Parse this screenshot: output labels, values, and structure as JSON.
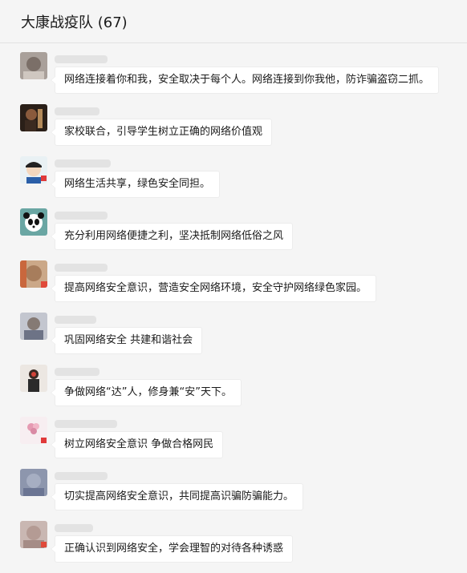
{
  "chat": {
    "title": "大康战疫队 (67)"
  },
  "messages": [
    {
      "text": "网络连接着你和我，安全取决于每个人。网络连接到你我他，防诈骗盗窃二抓。"
    },
    {
      "text": "家校联合，引导学生树立正确的网络价值观"
    },
    {
      "text": "网络生活共享，绿色安全同担。"
    },
    {
      "text": "充分利用网络便捷之利，坚决抵制网络低俗之风"
    },
    {
      "text": "提高网络安全意识，营造安全网络环境，安全守护网络绿色家园。"
    },
    {
      "text": "巩固网络安全 共建和谐社会"
    },
    {
      "text": "争做网络“达”人，修身兼“安”天下。"
    },
    {
      "text": "树立网络安全意识  争做合格网民"
    },
    {
      "text": "切实提高网络安全意识，共同提高识骗防骗能力。"
    },
    {
      "text": "正确认识到网络安全，学会理智的对待各种诱惑"
    }
  ],
  "colors": {
    "background": "#f5f5f5",
    "bubble": "#ffffff",
    "text": "#1a1a1a"
  }
}
